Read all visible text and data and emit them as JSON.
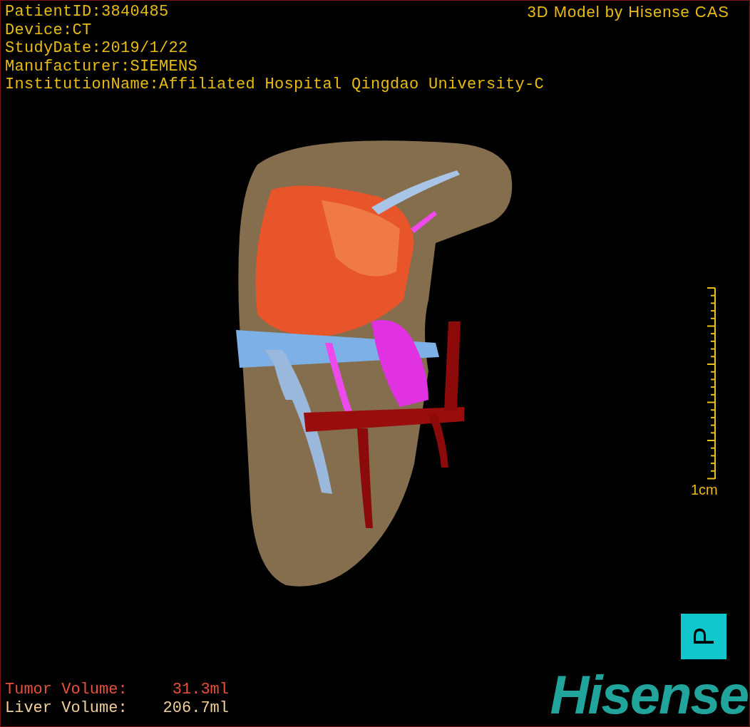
{
  "study_info": [
    "PatientID:3840485",
    "Device:CT",
    "StudyDate:2019/1/22",
    "Manufacturer:SIEMENS",
    "InstitutionName:Affiliated Hospital Qingdao University-C"
  ],
  "credit": "3D Model by Hisense CAS",
  "scale_bar": {
    "label": "1cm"
  },
  "orientation_marker": "P",
  "volumes": [
    {
      "label": "Tumor Volume:",
      "value": "31.3ml",
      "color": "#e8503a"
    },
    {
      "label": "Liver Volume:",
      "value": "206.7ml",
      "color": "#f2d09a"
    }
  ],
  "logo": "Hisense"
}
